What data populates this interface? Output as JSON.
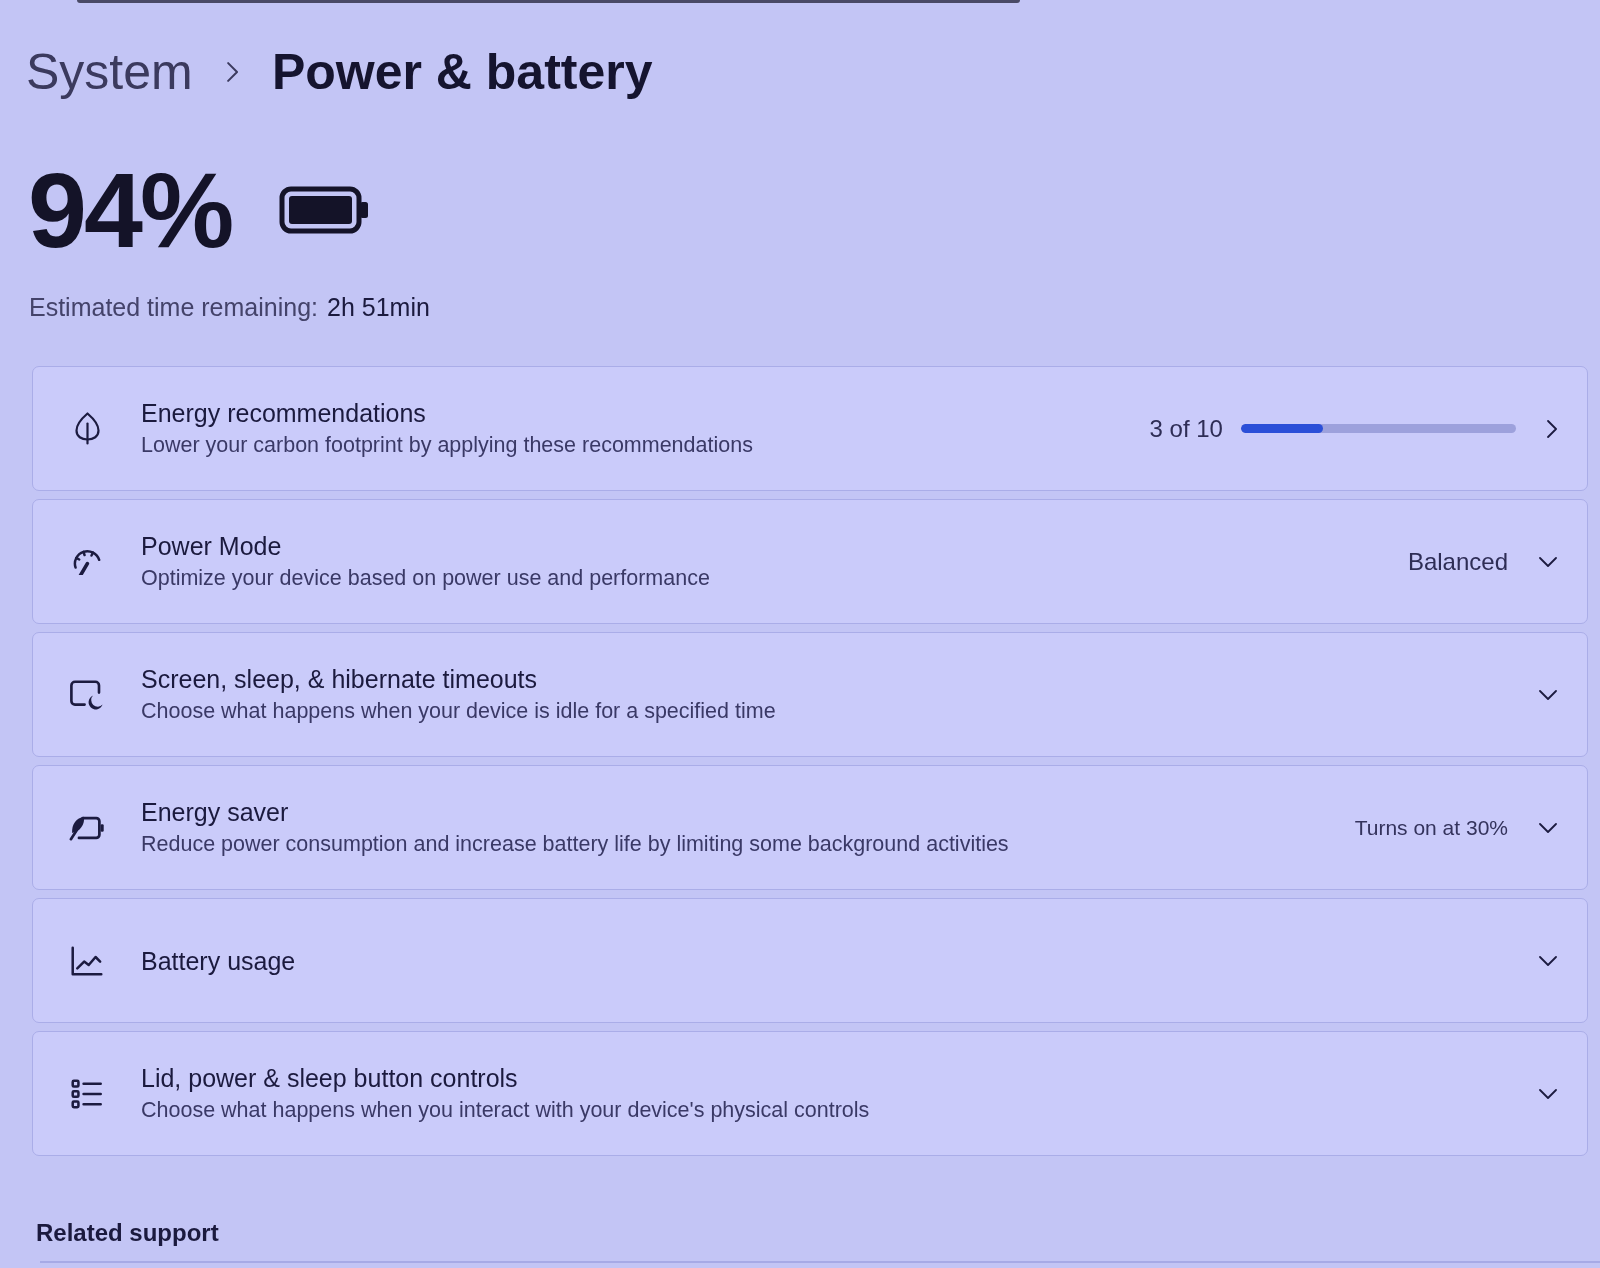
{
  "breadcrumb": {
    "parent": "System",
    "current": "Power & battery"
  },
  "battery": {
    "percentage": "94%",
    "estimate_label": "Estimated time remaining:",
    "estimate_value": "2h 51min"
  },
  "cards": [
    {
      "kind": "link",
      "title": "Energy recommendations",
      "description": "Lower your carbon footprint by applying these recommendations",
      "progress": {
        "label": "3 of 10",
        "level": 0.3
      }
    },
    {
      "kind": "select",
      "title": "Power Mode",
      "description": "Optimize your device based on power use and performance",
      "value": "Balanced"
    },
    {
      "kind": "expander",
      "title": "Screen, sleep, & hibernate timeouts",
      "description": "Choose what happens when your device is idle for a specified time"
    },
    {
      "kind": "expander",
      "title": "Energy saver",
      "description": "Reduce power consumption and increase battery life by limiting some background activities",
      "value": "Turns on at 30%"
    },
    {
      "kind": "expander",
      "title": "Battery usage"
    },
    {
      "kind": "expander",
      "title": "Lid, power & sleep button controls",
      "description": "Choose what happens when you interact with your device's physical controls"
    }
  ],
  "related_support": {
    "title": "Related support"
  }
}
